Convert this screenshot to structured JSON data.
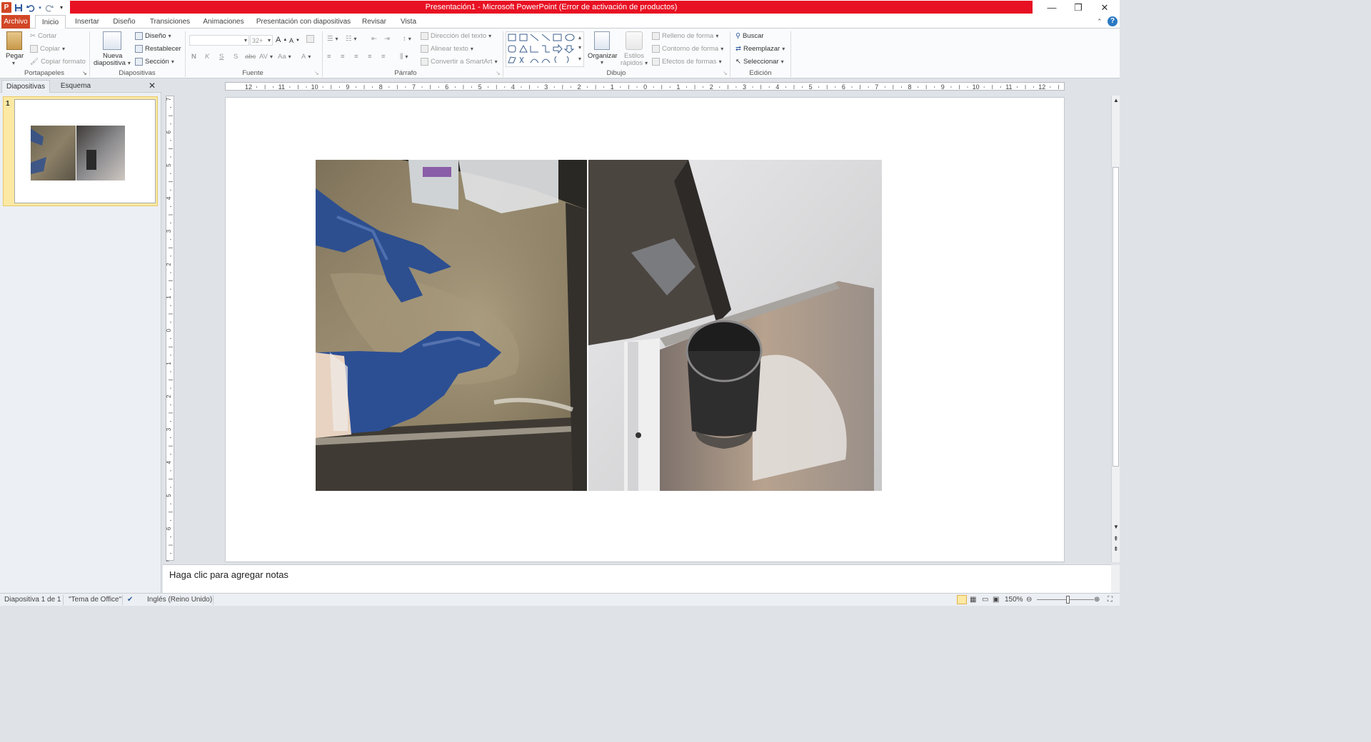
{
  "window": {
    "title": "Presentación1 - Microsoft PowerPoint (Error de activación de productos)",
    "app_icon": "P"
  },
  "qat": {
    "icons": [
      "powerpoint-icon",
      "save-icon",
      "undo-icon",
      "redo-icon",
      "customize-icon"
    ]
  },
  "tabs": {
    "archivo": "Archivo",
    "inicio": "Inicio",
    "insertar": "Insertar",
    "diseno": "Diseño",
    "transiciones": "Transiciones",
    "animaciones": "Animaciones",
    "presentacion": "Presentación con diapositivas",
    "revisar": "Revisar",
    "vista": "Vista"
  },
  "ribbon": {
    "portapapeles": {
      "label": "Portapapeles",
      "pegar": "Pegar",
      "cortar": "Cortar",
      "copiar": "Copiar",
      "copiar_formato": "Copiar formato"
    },
    "diapositivas": {
      "label": "Diapositivas",
      "nueva_1": "Nueva",
      "nueva_2": "diapositiva",
      "diseno": "Diseño",
      "restablecer": "Restablecer",
      "seccion": "Sección"
    },
    "fuente": {
      "label": "Fuente",
      "font_name": "",
      "font_size": "32+",
      "bold": "N",
      "italic": "K",
      "underline": "S",
      "shadow": "S",
      "strike": "abc",
      "spacing": "AV",
      "case": "Aa",
      "color": "A"
    },
    "parrafo": {
      "label": "Párrafo",
      "direccion": "Dirección del texto",
      "alinear": "Alinear texto",
      "smartart": "Convertir a SmartArt"
    },
    "dibujo": {
      "label": "Dibujo",
      "organizar": "Organizar",
      "estilos_1": "Estilos",
      "estilos_2": "rápidos",
      "relleno": "Relleno de forma",
      "contorno": "Contorno de forma",
      "efectos": "Efectos de formas"
    },
    "edicion": {
      "label": "Edición",
      "buscar": "Buscar",
      "reemplazar": "Reemplazar",
      "seleccionar": "Seleccionar"
    }
  },
  "left_pane": {
    "tab_diapositivas": "Diapositivas",
    "tab_esquema": "Esquema",
    "slide_number": "1"
  },
  "ruler": {
    "h_labels": [
      "12",
      "11",
      "10",
      "9",
      "8",
      "7",
      "6",
      "5",
      "4",
      "3",
      "2",
      "1",
      "0",
      "1",
      "2",
      "3",
      "4",
      "5",
      "6",
      "7",
      "8",
      "9",
      "10",
      "11",
      "12"
    ],
    "v_labels": [
      "7",
      "6",
      "5",
      "4",
      "3",
      "2",
      "1",
      "0",
      "1",
      "2",
      "3",
      "4",
      "5",
      "6",
      "7"
    ]
  },
  "notes": {
    "placeholder": "Haga clic para agregar notas"
  },
  "status": {
    "slide": "Diapositiva 1 de 1",
    "theme": "\"Tema de Office\"",
    "language": "Inglés (Reino Unido)",
    "zoom": "150%"
  }
}
